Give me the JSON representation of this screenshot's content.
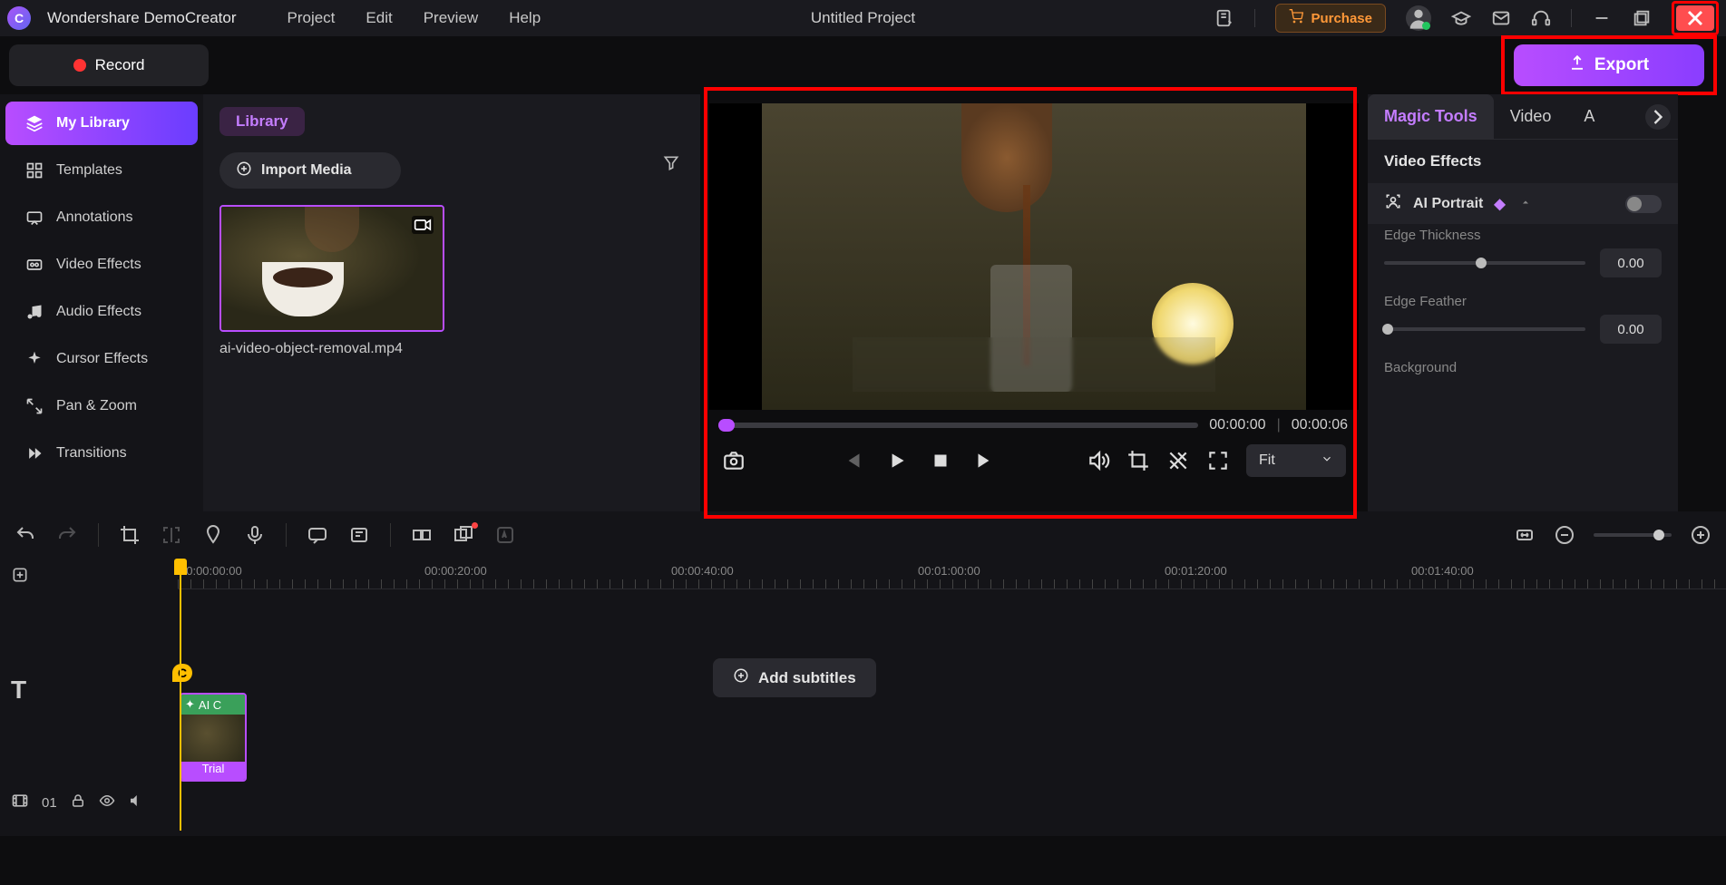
{
  "titlebar": {
    "app_name": "Wondershare DemoCreator",
    "menus": [
      "Project",
      "Edit",
      "Preview",
      "Help"
    ],
    "project_title": "Untitled Project",
    "purchase_label": "Purchase"
  },
  "row2": {
    "record_label": "Record",
    "export_label": "Export"
  },
  "sidebar": {
    "items": [
      {
        "label": "My Library",
        "icon": "layers-icon"
      },
      {
        "label": "Templates",
        "icon": "grid-icon"
      },
      {
        "label": "Annotations",
        "icon": "annotation-icon"
      },
      {
        "label": "Video Effects",
        "icon": "video-fx-icon"
      },
      {
        "label": "Audio Effects",
        "icon": "audio-note-icon"
      },
      {
        "label": "Cursor Effects",
        "icon": "cursor-sparkle-icon"
      },
      {
        "label": "Pan & Zoom",
        "icon": "pan-zoom-icon"
      },
      {
        "label": "Transitions",
        "icon": "transitions-icon"
      }
    ]
  },
  "library": {
    "badge": "Library",
    "import_label": "Import Media",
    "clip_name": "ai-video-object-removal.mp4"
  },
  "preview": {
    "time_current": "00:00:00",
    "time_total": "00:00:06",
    "fit_label": "Fit"
  },
  "properties": {
    "tabs": [
      "Magic Tools",
      "Video",
      "A"
    ],
    "section": "Video Effects",
    "ai_portrait_label": "AI Portrait",
    "edge_thickness_label": "Edge Thickness",
    "edge_thickness_value": "0.00",
    "edge_feather_label": "Edge Feather",
    "edge_feather_value": "0.00",
    "background_label": "Background",
    "edge_thickness_knob_pct": 48,
    "edge_feather_knob_pct": 2
  },
  "timeline": {
    "track_count": "01",
    "ruler": [
      "00:00:00:00",
      "00:00:20:00",
      "00:00:40:00",
      "00:01:00:00",
      "00:01:20:00",
      "00:01:40:00"
    ],
    "add_subtitles_label": "Add subtitles",
    "text_marker": "C",
    "clip_label": "AI C",
    "clip_badge": "Trial"
  },
  "colors": {
    "accent": "#b84dff",
    "highlight_red": "#ff0000",
    "warning_orange": "#ff9838",
    "playhead": "#ffbf00"
  }
}
